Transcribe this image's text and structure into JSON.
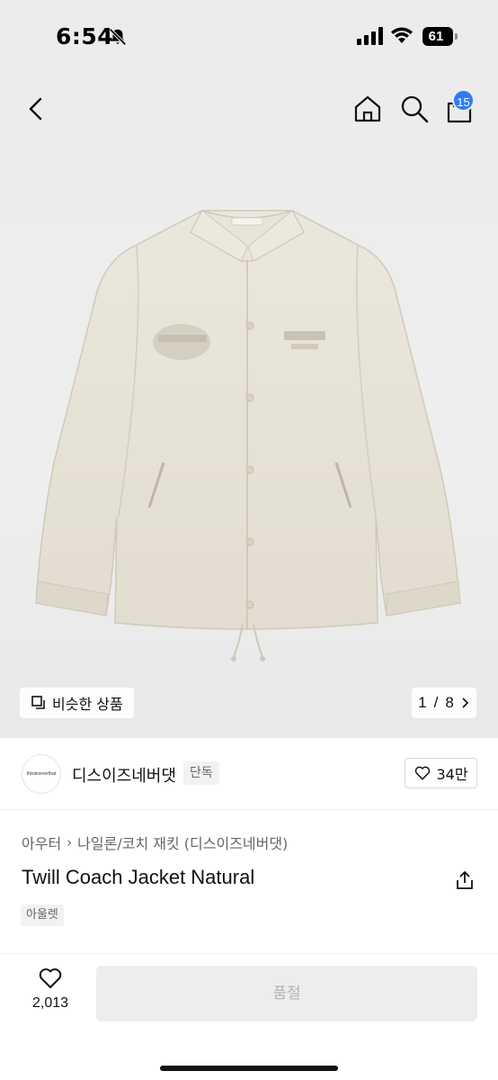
{
  "status_bar": {
    "time": "6:54",
    "battery": "61"
  },
  "nav": {
    "back_icon": "chevron-left-icon",
    "home_icon": "home-icon",
    "search_icon": "search-icon",
    "cart_icon": "shopping-bag-icon",
    "cart_count": "15"
  },
  "hero": {
    "similar_label": "비슷한 상품",
    "page_current": "1",
    "page_separator": "/",
    "page_total": "8"
  },
  "brand": {
    "logo_text": "thisisneverthat",
    "name": "디스이즈네버댓",
    "tag": "단독",
    "likes": "34만"
  },
  "product": {
    "category": [
      "아우터",
      "나일론/코치 재킷 (디스이즈네버댓)"
    ],
    "title": "Twill Coach Jacket Natural",
    "tag": "아울렛"
  },
  "bottom": {
    "wish_count": "2,013",
    "buy_label": "품절"
  },
  "colors": {
    "accent": "#2e7bf6",
    "jacket": "#e6e2d6"
  }
}
